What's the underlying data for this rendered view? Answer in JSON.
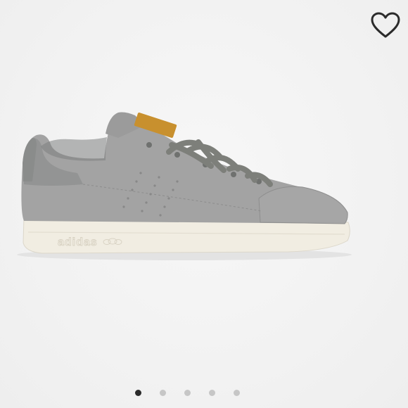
{
  "product_image": {
    "alt": "",
    "shoe_color": "#a3a3a3",
    "sole_color": "#f1ede2",
    "lace_color": "#7d7f7a",
    "heel_tab_color": "#c8902e",
    "sole_wordmark": "adidas"
  },
  "favorite": {
    "icon": "heart-outline-icon",
    "color": "#2b2b2b",
    "active": false
  },
  "gallery": {
    "total_images": 5,
    "current_index": 1
  }
}
